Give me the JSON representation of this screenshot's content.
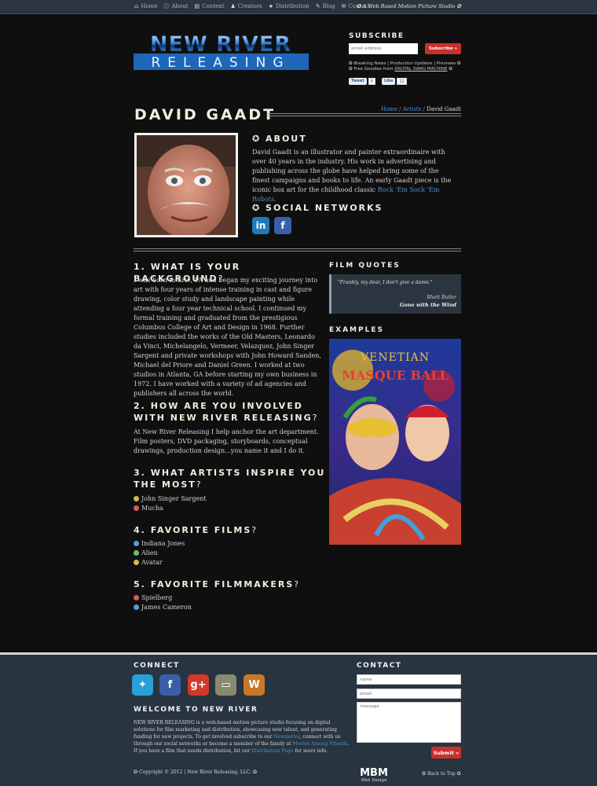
{
  "topnav": {
    "items": [
      {
        "icon": "home-icon",
        "label": "Home"
      },
      {
        "icon": "info-icon",
        "label": "About"
      },
      {
        "icon": "content-icon",
        "label": "Content"
      },
      {
        "icon": "user-icon",
        "label": "Creators"
      },
      {
        "icon": "star-icon",
        "label": "Distribution"
      },
      {
        "icon": "pencil-icon",
        "label": "Blog"
      },
      {
        "icon": "mail-icon",
        "label": "Contact"
      }
    ],
    "tagline": "A Web Based Motion Picture Studio"
  },
  "logo": {
    "line1": "NEW RIVER",
    "line2": "RELEASING"
  },
  "subscribe": {
    "title": "SUBSCRIBE",
    "email_placeholder": "email address",
    "button_label": "Subscribe »",
    "line1": "Breaking News | Production Updates | Previews",
    "line2_prefix": "Free Goodies from ",
    "line2_link": "DIGITAL SWAG MACHINE",
    "tweet_label": "Tweet",
    "tweet_count": "0",
    "like_label": "Like",
    "like_count": "12"
  },
  "page": {
    "title": "DAVID GAADT"
  },
  "breadcrumb": {
    "home": "Home",
    "sep": "/",
    "artists": "Artists",
    "current": "David Gaadt"
  },
  "about": {
    "heading": "ABOUT",
    "text": "David Gaadt is an illustrator and painter extraordinaire with over 40 years in the industry. His work in advertising and publishing across the globe have helped bring some of the finest campaigns and books to life. An early Gaadt piece is the iconic box art for the childhood classic ",
    "link": "Rock 'Em Sock 'Em Robots."
  },
  "social": {
    "heading": "SOCIAL NETWORKS",
    "linkedin": "in",
    "facebook": "f"
  },
  "questions": [
    {
      "num": "1.",
      "title": "WHAT IS YOUR BACKGROUND",
      "qmark": "?",
      "body": "I was born in Erie, PA and began my exciting journey into art with four years of intense training in cast and figure drawing, color study and landscape painting while attending a four year technical school. I continued my formal training and graduated from the prestigious Columbus College of Art and Design in 1968. Further studies included the works of the Old Masters, Leonardo da Vinci, Michelangelo, Vermeer, Velazquez, John Singer Sargent and private workshops with John Howard Sanden, Michael del Priore and Daniel Green. I worked at two studios in Atlanta, GA before starting my own business in 1972. I have worked with a variety of ad agencies and publishers all across the world."
    },
    {
      "num": "2.",
      "title": "HOW ARE YOU INVOLVED WITH NEW RIVER RELEASING",
      "qmark": "?",
      "body": "At New River Releasing I help anchor the art department. Film posters, DVD packaging, storyboards, conceptual drawings, production design...you name it and I do it."
    },
    {
      "num": "3.",
      "title": "WHAT ARTISTS INSPIRE YOU THE MOST",
      "qmark": "?",
      "items": [
        "John Singer Sargent",
        "Mucha"
      ]
    },
    {
      "num": "4.",
      "title": "FAVORITE FILMS",
      "qmark": "?",
      "items": [
        "Indiana Jones",
        "Alien",
        "Avatar"
      ]
    },
    {
      "num": "5.",
      "title": "FAVORITE FILMMAKERS",
      "qmark": "?",
      "items": [
        "Spielberg",
        "James Cameron"
      ]
    }
  ],
  "film_quotes": {
    "heading": "FILM QUOTES",
    "quote": "\"Frankly, my dear, I don't give a damn.\"",
    "author": "Rhett Butler",
    "film": "Gone with the Wind"
  },
  "examples": {
    "heading": "EXAMPLES",
    "art_line1": "VENETIAN",
    "art_line2": "MASQUE BALL"
  },
  "footer": {
    "connect_heading": "CONNECT",
    "welcome_heading": "WELCOME TO NEW RIVER",
    "welcome_1": "NEW RIVER RELEASING is a web-based motion picture studio focusing on digital solutions for film marketing and distribution, showcasing new talent, and generating funding for new projects. To get involved subscribe to our ",
    "newsletter_link": "Newsletter",
    "welcome_2": ", connect with us through our social networks or become a member of the family at ",
    "movies_link": "Movies Among Friends",
    "welcome_3": ". If you have a film that needs distribution, hit our ",
    "dist_link": "Distribution Page",
    "welcome_4": " for more info.",
    "contact_heading": "CONTACT",
    "name_placeholder": "name",
    "email_placeholder": "email",
    "message_placeholder": "message",
    "submit_label": "Submit »",
    "copyright": "Copyright © 2012 | New River Releasing, LLC.",
    "mbm_logo": "MBM",
    "mbm_sub": "Web Design",
    "back_to_top": "Back to Top"
  }
}
